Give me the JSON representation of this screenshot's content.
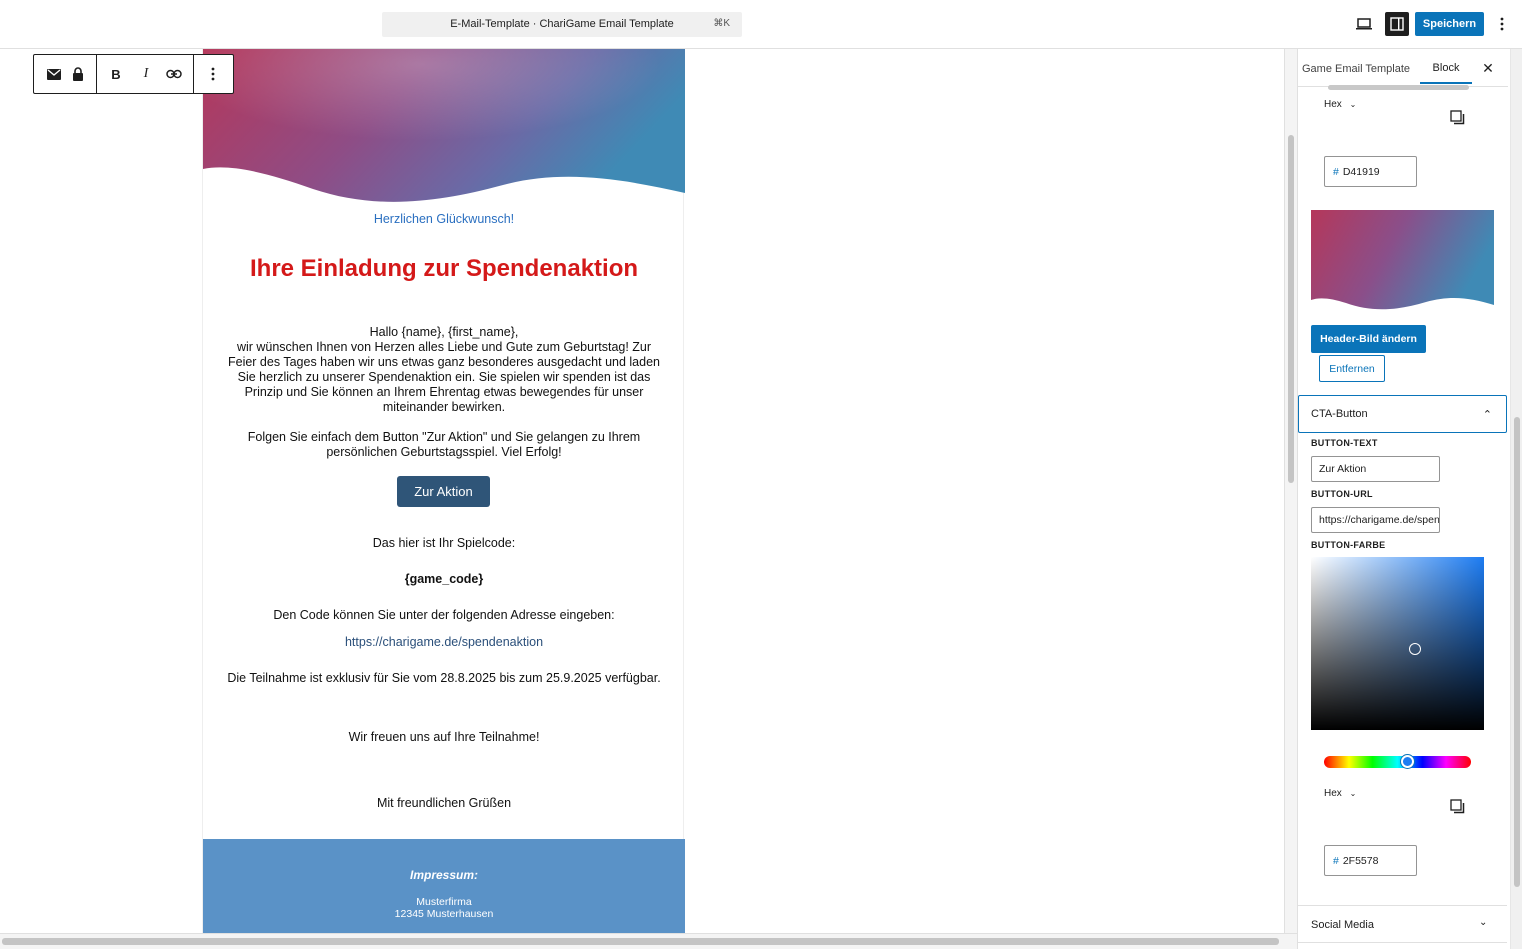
{
  "topbar": {
    "document_title": "E-Mail-Template · ChariGame Email Template",
    "shortcut": "⌘K",
    "save_label": "Speichern",
    "icons": [
      "desktop-preview-icon",
      "sidebar-toggle-icon",
      "more-options-icon"
    ]
  },
  "block_toolbar": {
    "icons": [
      "email-icon",
      "lock-icon",
      "bold-icon",
      "italic-icon",
      "link-icon",
      "more-options-icon"
    ],
    "bold": "B",
    "italic": "I"
  },
  "email": {
    "congrats": "Herzlichen Glückwunsch!",
    "headline": "Ihre Einladung zur Spendenaktion",
    "greeting": "Hallo {name}, {first_name},",
    "body_1": "wir wünschen Ihnen von Herzen alles Liebe und Gute zum Geburtstag! Zur Feier des Tages haben wir uns etwas ganz besonderes ausgedacht und laden Sie herzlich zu unserer Spendenaktion ein. Sie spielen wir spenden ist das Prinzip und Sie können an Ihrem Ehrentag etwas bewegendes für unser miteinander bewirken.",
    "body_2": "Folgen Sie einfach dem Button \"Zur Aktion\" und Sie gelangen zu Ihrem persönlichen Geburtstagsspiel. Viel Erfolg!",
    "cta_label": "Zur Aktion",
    "code_intro": "Das hier ist Ihr Spielcode:",
    "game_code": "{game_code}",
    "address_intro": "Den Code können Sie unter der folgenden Adresse eingeben:",
    "link": "https://charigame.de/spendenaktion",
    "period": "Die Teilnahme ist exklusiv für Sie vom 28.8.2025 bis zum 25.9.2025 verfügbar.",
    "closing_1": "Wir freuen uns auf Ihre Teilnahme!",
    "closing_2": "Mit freundlichen Grüßen",
    "footer": {
      "title": "Impressum:",
      "company": "Musterfirma",
      "city": "12345 Musterhausen"
    },
    "colors": {
      "headline": "#D41919",
      "button": "#2F5578",
      "footer": "#5A92C7"
    }
  },
  "sidebar": {
    "tab_document": "Game Email Template",
    "tab_block": "Block",
    "close_icon": "close-icon",
    "headline_color": {
      "format": "Hex",
      "value": "D41919"
    },
    "header_image": {
      "change_label": "Header-Bild ändern",
      "remove_label": "Entfernen"
    },
    "cta_panel": {
      "title": "CTA-Button",
      "button_text_label": "BUTTON-TEXT",
      "button_text_value": "Zur Aktion",
      "button_url_label": "BUTTON-URL",
      "button_url_value": "https://charigame.de/spendenaktion",
      "button_color_label": "BUTTON-FARBE",
      "color_format": "Hex",
      "color_value": "2F5578",
      "hue_position": 0.57
    },
    "social_media_label": "Social Media"
  }
}
